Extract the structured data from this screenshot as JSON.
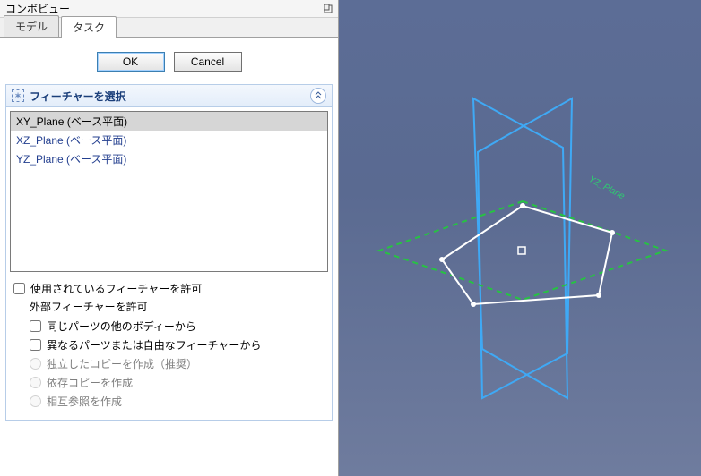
{
  "panel": {
    "title": "コンボビュー",
    "tabs": [
      {
        "label": "モデル",
        "active": false
      },
      {
        "label": "タスク",
        "active": true
      }
    ]
  },
  "dialog": {
    "ok": "OK",
    "cancel": "Cancel"
  },
  "section": {
    "title": "フィーチャーを選択",
    "features": [
      "XY_Plane (ベース平面)",
      "XZ_Plane (ベース平面)",
      "YZ_Plane (ベース平面)"
    ],
    "selected_index": 0,
    "options": {
      "allow_used": "使用されているフィーチャーを許可",
      "allow_external": "外部フィーチャーを許可",
      "from_other_bodies": "同じパーツの他のボディーから",
      "from_other_parts": "異なるパーツまたは自由なフィーチャーから",
      "copy_independent": "独立したコピーを作成（推奨）",
      "copy_dependent": "依存コピーを作成",
      "cross_reference": "相互参照を作成"
    }
  },
  "viewport": {
    "plane_label": "YZ_Plane",
    "colors": {
      "xy_plane": "#27c243",
      "xz_plane": "#3fa9f5",
      "yz_plane": "#3fa9f5",
      "sketch": "#ffffff"
    }
  }
}
